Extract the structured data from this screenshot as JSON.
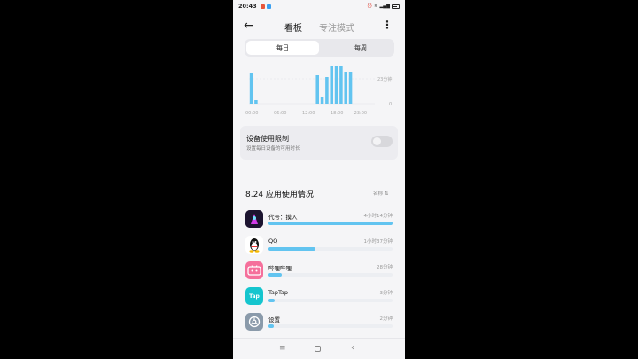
{
  "status_bar": {
    "time": "20:43"
  },
  "header": {
    "back_icon": "←",
    "tab_dashboard": "看板",
    "tab_focus": "专注模式",
    "more_icon": "⋮"
  },
  "segment": {
    "daily": "每日",
    "weekly": "每周"
  },
  "chart_data": {
    "type": "bar",
    "x_ticks": [
      "00:00",
      "06:00",
      "12:00",
      "18:00",
      "23:00"
    ],
    "y_ticks": [
      "23分钟",
      "0"
    ],
    "hours": [
      0,
      1,
      2,
      3,
      4,
      5,
      6,
      7,
      8,
      9,
      10,
      11,
      12,
      13,
      14,
      15,
      16,
      17,
      18,
      19,
      20,
      21,
      22,
      23
    ],
    "values": [
      35,
      4,
      0,
      0,
      0,
      0,
      0,
      0,
      0,
      0,
      0,
      0,
      0,
      0,
      32,
      8,
      30,
      42,
      42,
      42,
      36,
      36,
      0,
      0
    ],
    "ylim": [
      0,
      46
    ],
    "color": "#62c4f0"
  },
  "limit": {
    "title": "设备使用限制",
    "subtitle": "设置每日设备的可用时长"
  },
  "usage": {
    "title": "8.24 应用使用情况",
    "sort_label": "名称 ⇅"
  },
  "apps": [
    {
      "name": "代号：摸入",
      "time": "4小时14分钟",
      "fraction": 1.0,
      "icon": "game-icon",
      "color": "#2b1a3a"
    },
    {
      "name": "QQ",
      "time": "1小时37分钟",
      "fraction": 0.38,
      "icon": "qq-penguin-icon",
      "color": "#ffffff"
    },
    {
      "name": "哔哩哔哩",
      "time": "28分钟",
      "fraction": 0.11,
      "icon": "bilibili-icon",
      "color": "#f56f9b"
    },
    {
      "name": "TapTap",
      "time": "3分钟",
      "fraction": 0.05,
      "icon": "taptap-icon",
      "color": "#15c5ce"
    },
    {
      "name": "设置",
      "time": "2分钟",
      "fraction": 0.04,
      "icon": "settings-icon",
      "color": "#8a9aaa"
    }
  ],
  "navbar": {
    "menu": "≡",
    "back": "‹"
  }
}
